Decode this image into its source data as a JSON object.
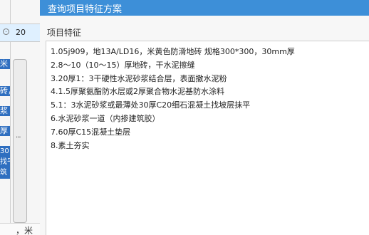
{
  "left_table": {
    "top_row_text": "",
    "selected_row_value": "20",
    "highlight_chars": [
      "米",
      "砖，",
      "浆",
      "厚",
      "30\n找平\n筑"
    ],
    "bottom_row_text": "，米"
  },
  "dialog": {
    "title": "查询项目特征方案",
    "section_label": "项目特征",
    "lines": [
      "1.05j909，地13A/LD16，米黄色防滑地砖 规格300*300，30mm厚",
      "2.8～10（10～15）厚地砖，干水泥擦缝",
      "3.20厚1：3干硬性水泥砂浆结合层，表面撒水泥粉",
      "4.1.5厚聚氨酯防水层或2厚聚合物水泥基防水涂料",
      "5.1：3水泥砂浆或最薄处30厚C20细石混凝土找坡层抹平",
      "6.水泥砂浆一道（内掺建筑胶）",
      "7.60厚C15混凝土垫层",
      "8.素土夯实"
    ]
  }
}
